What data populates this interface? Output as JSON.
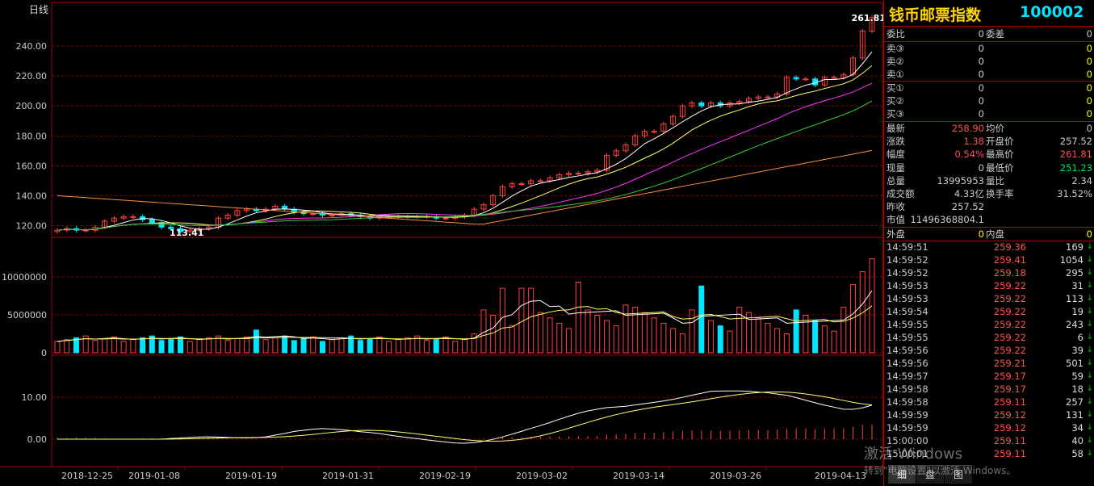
{
  "title": {
    "name": "钱币邮票指数",
    "code": "100002"
  },
  "chart": {
    "period": "日线",
    "price_high_label": "261.81",
    "price_low_label": "113.41",
    "price_axis": [
      "240.00",
      "220.00",
      "200.00",
      "180.00",
      "160.00",
      "140.00",
      "120.00"
    ],
    "volume_axis": [
      "10000000",
      "5000000",
      "0"
    ],
    "macd_axis": [
      "10.00",
      "0.00"
    ],
    "dates": [
      "2018-12-25",
      "2019-01-08",
      "2019-01-19",
      "2019-01-31",
      "2019-02-19",
      "2019-03-02",
      "2019-03-14",
      "2019-03-26",
      "2019-04-13"
    ]
  },
  "chart_data": {
    "type": "candlestick",
    "close": [
      117,
      118,
      117,
      117,
      119,
      123,
      125,
      126,
      126,
      124,
      122,
      119,
      118,
      116,
      117,
      118,
      119,
      125,
      127,
      130,
      131,
      130,
      131,
      133,
      131,
      129,
      128,
      128,
      127,
      127,
      128,
      127,
      126,
      125,
      126,
      126,
      126,
      126,
      126,
      126,
      125,
      125,
      126,
      127,
      131,
      134,
      140,
      146,
      148,
      148,
      150,
      150,
      152,
      154,
      155,
      155,
      156,
      157,
      167,
      170,
      174,
      180,
      183,
      183,
      188,
      193,
      200,
      202,
      200,
      202,
      200,
      202,
      203,
      205,
      206,
      206,
      208,
      219,
      218,
      218,
      214,
      219,
      219,
      221,
      232,
      250,
      259
    ],
    "series": [
      {
        "name": "volume"
      },
      {
        "name": "MA5"
      },
      {
        "name": "MA10"
      },
      {
        "name": "MA20"
      },
      {
        "name": "MA60"
      }
    ]
  },
  "orderbook": {
    "ratio": {
      "l1": "委比",
      "v1": "0",
      "l2": "委差",
      "v2": "0"
    },
    "sells": [
      {
        "label": "卖③",
        "price": "0",
        "vol": "0"
      },
      {
        "label": "卖②",
        "price": "0",
        "vol": "0"
      },
      {
        "label": "卖①",
        "price": "0",
        "vol": "0"
      }
    ],
    "buys": [
      {
        "label": "买①",
        "price": "0",
        "vol": "0"
      },
      {
        "label": "买②",
        "price": "0",
        "vol": "0"
      },
      {
        "label": "买③",
        "price": "0",
        "vol": "0"
      }
    ]
  },
  "quote": [
    {
      "l1": "最新",
      "v1": "258.90",
      "c1": "#ff5050",
      "l2": "均价",
      "v2": "0",
      "c2": "#ccc"
    },
    {
      "l1": "涨跌",
      "v1": "1.38",
      "c1": "#ff5050",
      "l2": "开盘价",
      "v2": "257.52",
      "c2": "#ccc"
    },
    {
      "l1": "幅度",
      "v1": "0.54%",
      "c1": "#ff5050",
      "l2": "最高价",
      "v2": "261.81",
      "c2": "#ff5050"
    },
    {
      "l1": "现量",
      "v1": "0",
      "c1": "#ccc",
      "l2": "最低价",
      "v2": "251.23",
      "c2": "#00e060"
    },
    {
      "l1": "总量",
      "v1": "13995953",
      "c1": "#ccc",
      "l2": "量比",
      "v2": "2.34",
      "c2": "#ccc"
    },
    {
      "l1": "成交额",
      "v1": "4.33亿",
      "c1": "#ccc",
      "l2": "换手率",
      "v2": "31.52%",
      "c2": "#ccc"
    },
    {
      "l1": "昨收",
      "v1": "257.52",
      "c1": "#ccc",
      "l2": "",
      "v2": "",
      "c2": "#ccc"
    },
    {
      "l1": "市值",
      "v1": "11496368804.1",
      "c1": "#ccc",
      "l2": "",
      "v2": "",
      "c2": "#ccc"
    }
  ],
  "outer": {
    "l1": "外盘",
    "v1": "0",
    "l2": "内盘",
    "v2": "0"
  },
  "ticks": [
    {
      "time": "14:59:51",
      "price": "259.36",
      "vol": "169"
    },
    {
      "time": "14:59:52",
      "price": "259.41",
      "vol": "1054"
    },
    {
      "time": "14:59:52",
      "price": "259.18",
      "vol": "295"
    },
    {
      "time": "14:59:53",
      "price": "259.22",
      "vol": "31"
    },
    {
      "time": "14:59:53",
      "price": "259.22",
      "vol": "113"
    },
    {
      "time": "14:59:54",
      "price": "259.22",
      "vol": "19"
    },
    {
      "time": "14:59:55",
      "price": "259.22",
      "vol": "243"
    },
    {
      "time": "14:59:55",
      "price": "259.22",
      "vol": "6"
    },
    {
      "time": "14:59:56",
      "price": "259.22",
      "vol": "39"
    },
    {
      "time": "14:59:56",
      "price": "259.21",
      "vol": "501"
    },
    {
      "time": "14:59:57",
      "price": "259.17",
      "vol": "59"
    },
    {
      "time": "14:59:58",
      "price": "259.17",
      "vol": "18"
    },
    {
      "time": "14:59:58",
      "price": "259.11",
      "vol": "257"
    },
    {
      "time": "14:59:59",
      "price": "259.12",
      "vol": "131"
    },
    {
      "time": "14:59:59",
      "price": "259.12",
      "vol": "34"
    },
    {
      "time": "15:00:00",
      "price": "259.11",
      "vol": "40"
    },
    {
      "time": "15:00:01",
      "price": "259.11",
      "vol": "58"
    }
  ],
  "tick_arrow": "↓",
  "tabs": [
    "细",
    "盘",
    "图"
  ],
  "watermark": {
    "line1": "激活 Windows",
    "line2": "转到\"电脑设置\"以激活 Windows。"
  },
  "colors": {
    "up": "#ff4040",
    "down": "#00e5ff",
    "grid": "#8b0000",
    "ma5": "#ffffff",
    "ma10": "#ffff66",
    "ma20": "#ff33ff",
    "ma30": "#33cc33",
    "ma60": "#ff8c3a"
  }
}
